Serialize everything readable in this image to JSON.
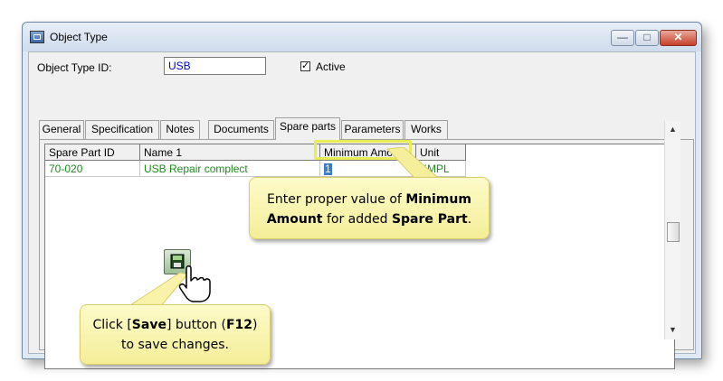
{
  "window": {
    "title": "Object Type",
    "controls": {
      "minimize": "—",
      "maximize": "□",
      "close": "✕"
    }
  },
  "form": {
    "object_type_id_label": "Object Type ID:",
    "object_type_id_value": "USB",
    "active_checked_mark": "✓",
    "active_label": "Active"
  },
  "tabs": [
    {
      "label": "General",
      "active": false
    },
    {
      "label": "Specification",
      "active": false
    },
    {
      "label": "Notes",
      "active": false
    },
    {
      "label": "Documents",
      "active": false
    },
    {
      "label": "Spare parts",
      "active": true
    },
    {
      "label": "Parameters",
      "active": false
    },
    {
      "label": "Works",
      "active": false
    }
  ],
  "grid": {
    "columns": [
      "Spare Part ID",
      "Name 1",
      "Minimum Amount",
      "Unit"
    ],
    "rows": [
      {
        "spare_part_id": "70-020",
        "name": "USB Repair complect",
        "minimum_amount": "1",
        "unit": "KMPL"
      }
    ]
  },
  "callouts": {
    "minimum_amount": {
      "line1_plain": "Enter proper value of ",
      "line1_bold": "Minimum",
      "line2_bold1": "Amount",
      "line2_plain": " for added ",
      "line2_bold2": "Spare Part",
      "line2_end": "."
    },
    "save": {
      "line1_a": "Click [",
      "line1_bold1": "Save",
      "line1_b": "] button (",
      "line1_bold2": "F12",
      "line1_c": ")",
      "line2": "to save changes."
    }
  },
  "icons": {
    "save": "floppy-disk-icon",
    "cursor": "hand-pointer-icon",
    "app": "object-type-icon"
  },
  "colors": {
    "grid_text": "#1f8a1f",
    "input_text": "#0000cc",
    "callout_fill": "#f7f1a3",
    "highlight": "#e8ee52",
    "selection": "#3a7ad8"
  }
}
